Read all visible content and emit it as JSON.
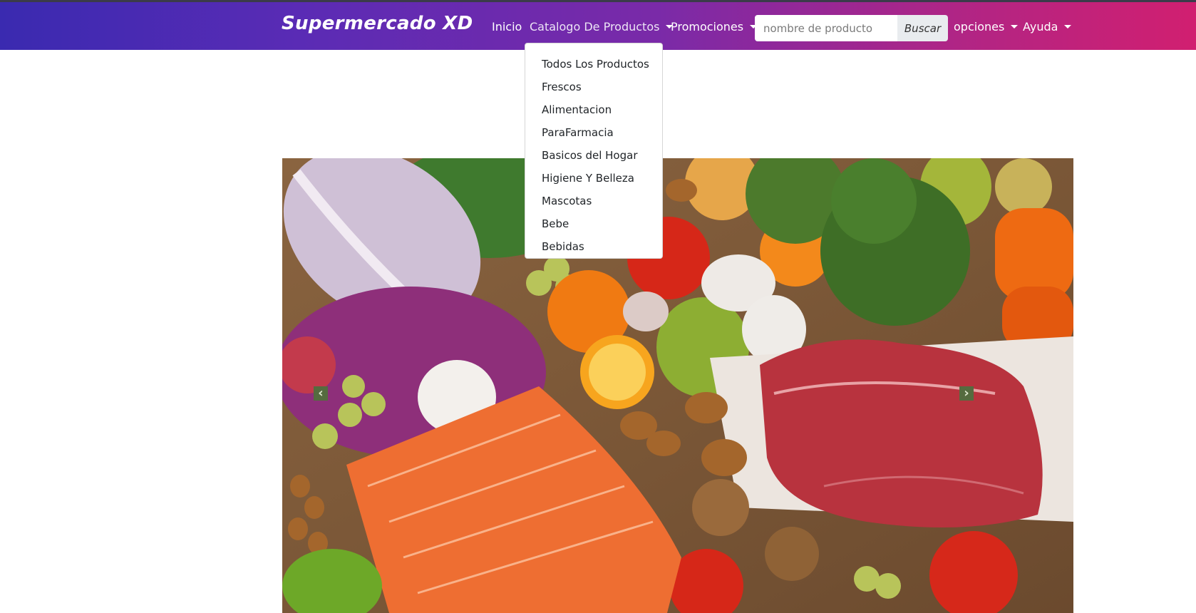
{
  "navbar": {
    "brand": "Supermercado XD",
    "inicio": "Inicio",
    "catalogo": "Catalogo De Productos",
    "promociones": "Promociones",
    "search_placeholder": "nombre de producto",
    "search_button": "Buscar",
    "opciones": "opciones",
    "ayuda": "Ayuda"
  },
  "dropdown": {
    "items": [
      "Todos Los Productos",
      "Frescos",
      "Alimentacion",
      "ParaFarmacia",
      "Basicos del Hogar",
      "Higiene Y Belleza",
      "Mascotas",
      "Bebe",
      "Bebidas"
    ]
  },
  "carousel": {
    "prev_icon": "‹",
    "next_icon": "›"
  },
  "colors": {
    "navbar_start": "#3a2ab0",
    "navbar_end": "#d11f70",
    "search_button_bg": "#e9ecef"
  }
}
